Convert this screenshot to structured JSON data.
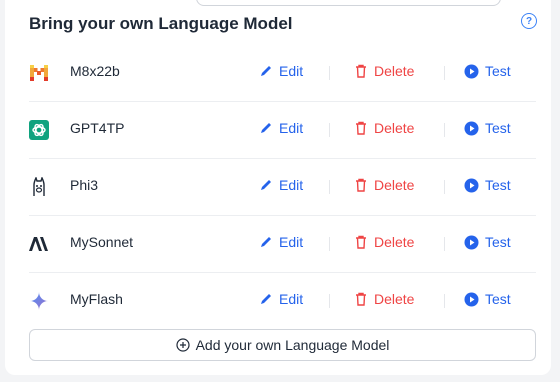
{
  "section": {
    "title": "Bring your own Language Model",
    "help_icon": "question-circle-icon"
  },
  "actions": {
    "edit_label": "Edit",
    "delete_label": "Delete",
    "test_label": "Test"
  },
  "models": [
    {
      "name": "M8x22b",
      "icon": "mistral-logo-icon"
    },
    {
      "name": "GPT4TP",
      "icon": "openai-logo-icon"
    },
    {
      "name": "Phi3",
      "icon": "llama-logo-icon"
    },
    {
      "name": "MySonnet",
      "icon": "anthropic-logo-icon"
    },
    {
      "name": "MyFlash",
      "icon": "gemini-logo-icon"
    }
  ],
  "add_button": {
    "label": "Add your own Language Model",
    "icon": "plus-circle-icon"
  },
  "colors": {
    "accent": "#2563eb",
    "danger": "#ef4444",
    "text": "#1f2937",
    "border": "#d1d5db"
  }
}
